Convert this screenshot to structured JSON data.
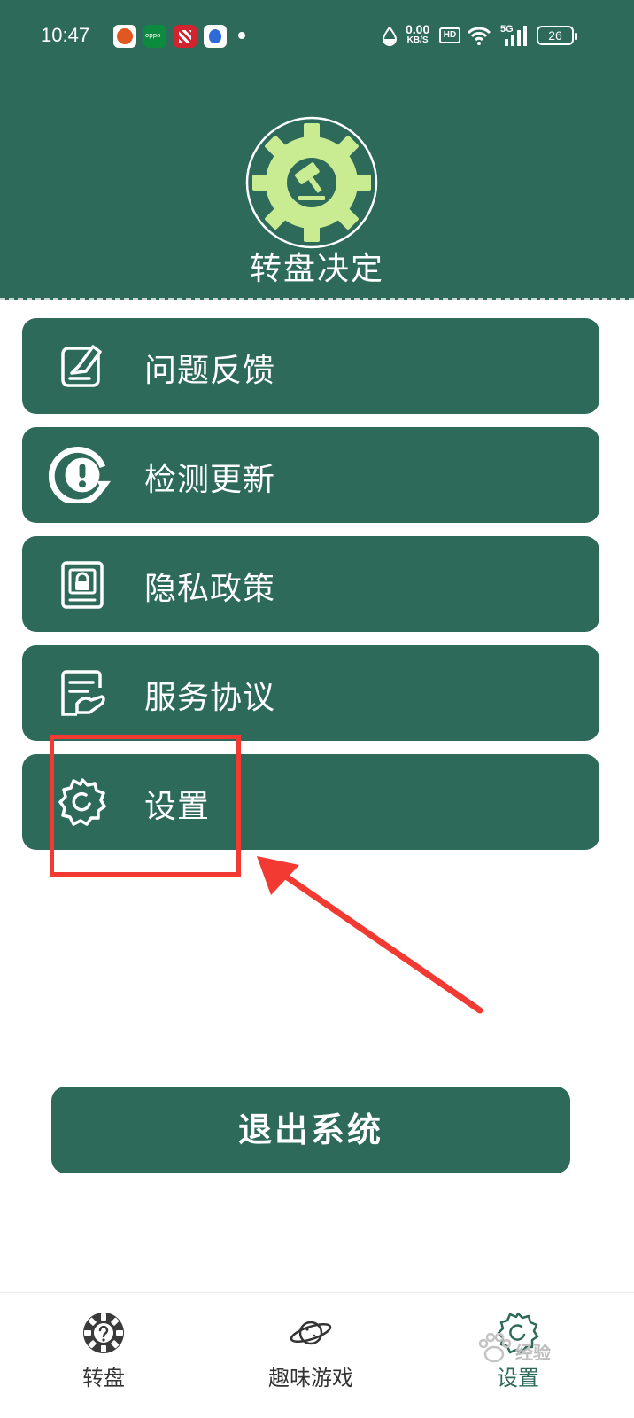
{
  "status_bar": {
    "time": "10:47",
    "net_speed": "0.00",
    "net_unit": "KB/S",
    "hd": "HD",
    "network": "5G",
    "battery": "26"
  },
  "header": {
    "app_title": "转盘决定",
    "logo_icon": "gavel-wheel-icon"
  },
  "menu": [
    {
      "label": "问题反馈",
      "icon": "feedback-edit-icon"
    },
    {
      "label": "检测更新",
      "icon": "update-check-icon"
    },
    {
      "label": "隐私政策",
      "icon": "privacy-lock-icon"
    },
    {
      "label": "服务协议",
      "icon": "service-agreement-icon"
    },
    {
      "label": "设置",
      "icon": "gear-icon"
    }
  ],
  "logout_label": "退出系统",
  "bottom_nav": [
    {
      "label": "转盘",
      "icon": "wheel-question-icon"
    },
    {
      "label": "趣味游戏",
      "icon": "planet-icon"
    },
    {
      "label": "设置",
      "icon": "gear-icon",
      "active": true
    }
  ],
  "watermark": "经验",
  "colors": {
    "primary": "#2d6a5a",
    "logo_accent": "#c9ec93",
    "annotation": "#f23a32"
  }
}
